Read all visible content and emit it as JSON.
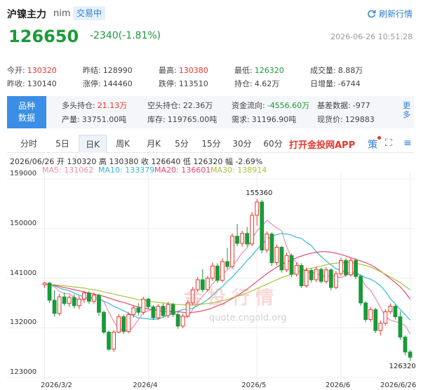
{
  "header": {
    "title": "沪镍主力",
    "code": "nim",
    "status_badge": "交易中",
    "refresh_label": "刷新行情",
    "price": "126650",
    "change": "-2340(-1.81%)",
    "timestamp": "2026-06-26 10:51:28"
  },
  "stats": [
    {
      "label": "今开:",
      "value": "130320",
      "color": "red"
    },
    {
      "label": "昨结:",
      "value": "128990",
      "color": ""
    },
    {
      "label": "最高:",
      "value": "130380",
      "color": "red"
    },
    {
      "label": "最低:",
      "value": "126320",
      "color": "green"
    },
    {
      "label": "成交量:",
      "value": "8.88万",
      "color": ""
    },
    {
      "label": "昨收:",
      "value": "130140",
      "color": ""
    },
    {
      "label": "涨停:",
      "value": "144460",
      "color": ""
    },
    {
      "label": "跌停:",
      "value": "113510",
      "color": ""
    },
    {
      "label": "持仓:",
      "value": "4.62万",
      "color": ""
    },
    {
      "label": "日增量:",
      "value": "-6744",
      "color": ""
    }
  ],
  "variety": {
    "label_line1": "品种",
    "label_line2": "数据",
    "more": "更多",
    "items": [
      {
        "label": "多头持仓:",
        "value": "21.13万",
        "color": "red"
      },
      {
        "label": "空头持仓:",
        "value": "22.36万",
        "color": ""
      },
      {
        "label": "资金流向:",
        "value": "-4556.60万",
        "color": "green"
      },
      {
        "label": "基差数据:",
        "value": "-977",
        "color": ""
      },
      {
        "label": "产量:",
        "value": "33751.00吨",
        "color": ""
      },
      {
        "label": "库存:",
        "value": "119765.00吨",
        "color": ""
      },
      {
        "label": "需求:",
        "value": "31196.90吨",
        "color": ""
      },
      {
        "label": "现货价:",
        "value": "129883",
        "color": ""
      }
    ]
  },
  "tabs": [
    "分时",
    "5日",
    "日K",
    "周K",
    "月K",
    "5分",
    "15分",
    "30分",
    "60分"
  ],
  "active_tab": "日K",
  "app_link": "打开金投网APP",
  "tools": {
    "strategy": "策",
    "fullscreen": "⛶",
    "menu": "≡"
  },
  "chart_header": {
    "ohlc": "2026/06/26  开 130320  高 130380  收 126640  低 126320  幅 -2.69%",
    "ma": [
      {
        "label": "MA5: 131062",
        "color": "#e88fb0"
      },
      {
        "label": "MA10: 133379",
        "color": "#37b8d8"
      },
      {
        "label": "MA20: 136601",
        "color": "#e8456a"
      },
      {
        "label": "MA30: 138914",
        "color": "#a8c23a"
      }
    ]
  },
  "watermark": {
    "text": "金投行情",
    "url": "quote.cngold.org"
  },
  "chart_data": {
    "type": "candlestick",
    "y_ticks": [
      159000,
      150000,
      141000,
      132000,
      123000
    ],
    "ylim": [
      123000,
      159000
    ],
    "x_ticks": [
      "2026/3/2",
      "2026/4",
      "2026/5",
      "2026/6",
      "2026/6/26"
    ],
    "annotations": {
      "high": "155360",
      "low": "126320"
    },
    "colors": {
      "up": "#e8352b",
      "down": "#1a9a3a"
    },
    "candles": [
      [
        139800,
        140300,
        139200,
        140100
      ],
      [
        140100,
        140300,
        136500,
        137000
      ],
      [
        137000,
        138800,
        134000,
        134600
      ],
      [
        134600,
        138200,
        134200,
        137600
      ],
      [
        137600,
        138400,
        136000,
        136400
      ],
      [
        136400,
        137900,
        135800,
        137500
      ],
      [
        137500,
        138100,
        135500,
        136000
      ],
      [
        136000,
        137800,
        135400,
        137200
      ],
      [
        137200,
        138700,
        136500,
        138300
      ],
      [
        138300,
        138700,
        136300,
        136800
      ],
      [
        136800,
        138400,
        136300,
        137900
      ],
      [
        137900,
        138200,
        134200,
        134800
      ],
      [
        134800,
        135100,
        130800,
        131200
      ],
      [
        131200,
        131500,
        127800,
        128100
      ],
      [
        128100,
        131600,
        127600,
        131200
      ],
      [
        131200,
        134500,
        131000,
        134000
      ],
      [
        134000,
        134400,
        130800,
        131300
      ],
      [
        131300,
        134800,
        131000,
        134400
      ],
      [
        134400,
        136100,
        133800,
        135600
      ],
      [
        135600,
        136500,
        134200,
        134800
      ],
      [
        134800,
        137600,
        134400,
        137200
      ],
      [
        137200,
        137400,
        135400,
        135800
      ],
      [
        135800,
        136100,
        133400,
        133800
      ],
      [
        133800,
        136300,
        133400,
        135900
      ],
      [
        135900,
        136400,
        133800,
        134200
      ],
      [
        134200,
        136700,
        133800,
        136200
      ],
      [
        136200,
        136500,
        133900,
        134400
      ],
      [
        134400,
        134800,
        131800,
        132300
      ],
      [
        132300,
        134600,
        131900,
        134100
      ],
      [
        134100,
        137000,
        133800,
        136500
      ],
      [
        136500,
        139400,
        136100,
        138900
      ],
      [
        138900,
        141200,
        138500,
        140700
      ],
      [
        140700,
        142600,
        138400,
        138900
      ],
      [
        138900,
        141400,
        138600,
        141000
      ],
      [
        141000,
        143800,
        140500,
        143200
      ],
      [
        143200,
        143700,
        140100,
        140600
      ],
      [
        140600,
        144600,
        140200,
        144000
      ],
      [
        144000,
        146500,
        142600,
        143100
      ],
      [
        143100,
        149100,
        142600,
        148600
      ],
      [
        148600,
        150800,
        146800,
        147300
      ],
      [
        147300,
        149600,
        146700,
        149100
      ],
      [
        149100,
        150300,
        146700,
        147200
      ],
      [
        147200,
        153000,
        146800,
        152400
      ],
      [
        152400,
        155360,
        150500,
        154800
      ],
      [
        154800,
        155200,
        145500,
        146100
      ],
      [
        146100,
        149500,
        145600,
        149000
      ],
      [
        149000,
        149300,
        143200,
        143800
      ],
      [
        143800,
        147100,
        143300,
        146600
      ],
      [
        146600,
        146900,
        142000,
        142500
      ],
      [
        142500,
        145600,
        142100,
        145100
      ],
      [
        145100,
        145500,
        141200,
        141700
      ],
      [
        141700,
        143800,
        141300,
        143300
      ],
      [
        143300,
        143700,
        139200,
        139600
      ],
      [
        139600,
        142900,
        139300,
        142400
      ],
      [
        142400,
        142800,
        140200,
        140700
      ],
      [
        140700,
        143100,
        140300,
        142600
      ],
      [
        142600,
        142900,
        140000,
        140400
      ],
      [
        140400,
        143000,
        140000,
        142500
      ],
      [
        142500,
        142800,
        138800,
        139300
      ],
      [
        139300,
        142300,
        139000,
        141800
      ],
      [
        141800,
        144700,
        141400,
        144200
      ],
      [
        144200,
        144600,
        141200,
        141600
      ],
      [
        141600,
        144700,
        141300,
        144200
      ],
      [
        144200,
        144600,
        140800,
        141300
      ],
      [
        141300,
        141700,
        136000,
        136500
      ],
      [
        136500,
        136800,
        133000,
        133500
      ],
      [
        133500,
        135800,
        133100,
        135300
      ],
      [
        135300,
        135600,
        131000,
        131500
      ],
      [
        131500,
        133300,
        130600,
        132800
      ],
      [
        132800,
        135400,
        132400,
        134900
      ],
      [
        134900,
        136400,
        134500,
        135900
      ],
      [
        135900,
        136200,
        133500,
        134000
      ],
      [
        134000,
        135000,
        129800,
        130300
      ],
      [
        130300,
        130600,
        127000,
        127600
      ],
      [
        127600,
        127900,
        126000,
        126650
      ]
    ],
    "ma_series": [
      {
        "name": "MA5",
        "color": "#e88fb0",
        "values": [
          139800,
          139900,
          139400,
          138600,
          138200,
          138200,
          137500,
          136900,
          137100,
          137400,
          137600,
          137500,
          136700,
          134900,
          133100,
          131800,
          131500,
          131400,
          132200,
          133500,
          134700,
          135100,
          135400,
          135300,
          135600,
          135300,
          134800,
          134300,
          133800,
          134000,
          135300,
          136600,
          137700,
          138700,
          140000,
          140800,
          141700,
          142500,
          143300,
          144300,
          145600,
          146500,
          148100,
          149600,
          150400,
          151500,
          150800,
          150100,
          149600,
          146700,
          144700,
          143800,
          142900,
          142100,
          142100,
          141900,
          141400,
          141300,
          141500,
          141200,
          141100,
          141500,
          141800,
          142400,
          141200,
          139600,
          138800,
          137300,
          135700,
          134000,
          133400,
          133100,
          132900,
          132400,
          130900
        ]
      },
      {
        "name": "MA10",
        "color": "#37b8d8",
        "values": [
          139800,
          139800,
          139600,
          139200,
          138900,
          138700,
          138300,
          137900,
          137600,
          137400,
          137300,
          137200,
          136800,
          136400,
          135900,
          135500,
          135100,
          134600,
          134200,
          133800,
          133700,
          133600,
          133500,
          133600,
          133900,
          134300,
          134700,
          135000,
          135300,
          135400,
          135500,
          136000,
          136500,
          137100,
          137900,
          138700,
          139500,
          140400,
          141200,
          142200,
          143100,
          144200,
          145100,
          146200,
          147200,
          148000,
          148600,
          148900,
          149100,
          149000,
          148800,
          148400,
          148200,
          147500,
          146900,
          145800,
          144900,
          144100,
          143400,
          142700,
          142400,
          142100,
          141900,
          141800,
          141500,
          141100,
          140800,
          140300,
          139600,
          138600,
          137300,
          136300,
          135300,
          134400,
          133400
        ]
      },
      {
        "name": "MA20",
        "color": "#e8456a",
        "values": [
          139800,
          139800,
          139700,
          139500,
          139300,
          139100,
          138900,
          138700,
          138500,
          138300,
          138100,
          137900,
          137700,
          137400,
          137100,
          136800,
          136600,
          136300,
          136000,
          135800,
          135600,
          135400,
          135200,
          135100,
          135000,
          134900,
          134900,
          134900,
          134800,
          134700,
          134800,
          134900,
          135100,
          135300,
          135600,
          136000,
          136300,
          136800,
          137300,
          137800,
          138400,
          139000,
          139700,
          140400,
          141100,
          141800,
          142400,
          143000,
          143500,
          143900,
          144300,
          144700,
          145000,
          145300,
          145500,
          145700,
          145800,
          145800,
          145700,
          145500,
          145300,
          145000,
          144700,
          144400,
          144100,
          143800,
          143400,
          142900,
          142300,
          141600,
          140900,
          140200,
          139400,
          138400,
          137200
        ]
      },
      {
        "name": "MA30",
        "color": "#a8c23a",
        "values": [
          139800,
          139800,
          139800,
          139700,
          139600,
          139500,
          139400,
          139300,
          139200,
          139000,
          138900,
          138700,
          138500,
          138300,
          138100,
          137900,
          137700,
          137500,
          137300,
          137100,
          137000,
          136800,
          136700,
          136600,
          136500,
          136400,
          136300,
          136200,
          136200,
          136100,
          136100,
          136200,
          136300,
          136400,
          136500,
          136700,
          136900,
          137100,
          137400,
          137700,
          138000,
          138300,
          138700,
          139100,
          139500,
          139900,
          140300,
          140700,
          141100,
          141400,
          141700,
          142000,
          142300,
          142600,
          142800,
          143000,
          143200,
          143400,
          143600,
          143700,
          143800,
          143800,
          143800,
          143700,
          143500,
          143300,
          143000,
          142600,
          142200,
          141700,
          141200,
          140700,
          140200,
          139500,
          138900
        ]
      }
    ]
  }
}
